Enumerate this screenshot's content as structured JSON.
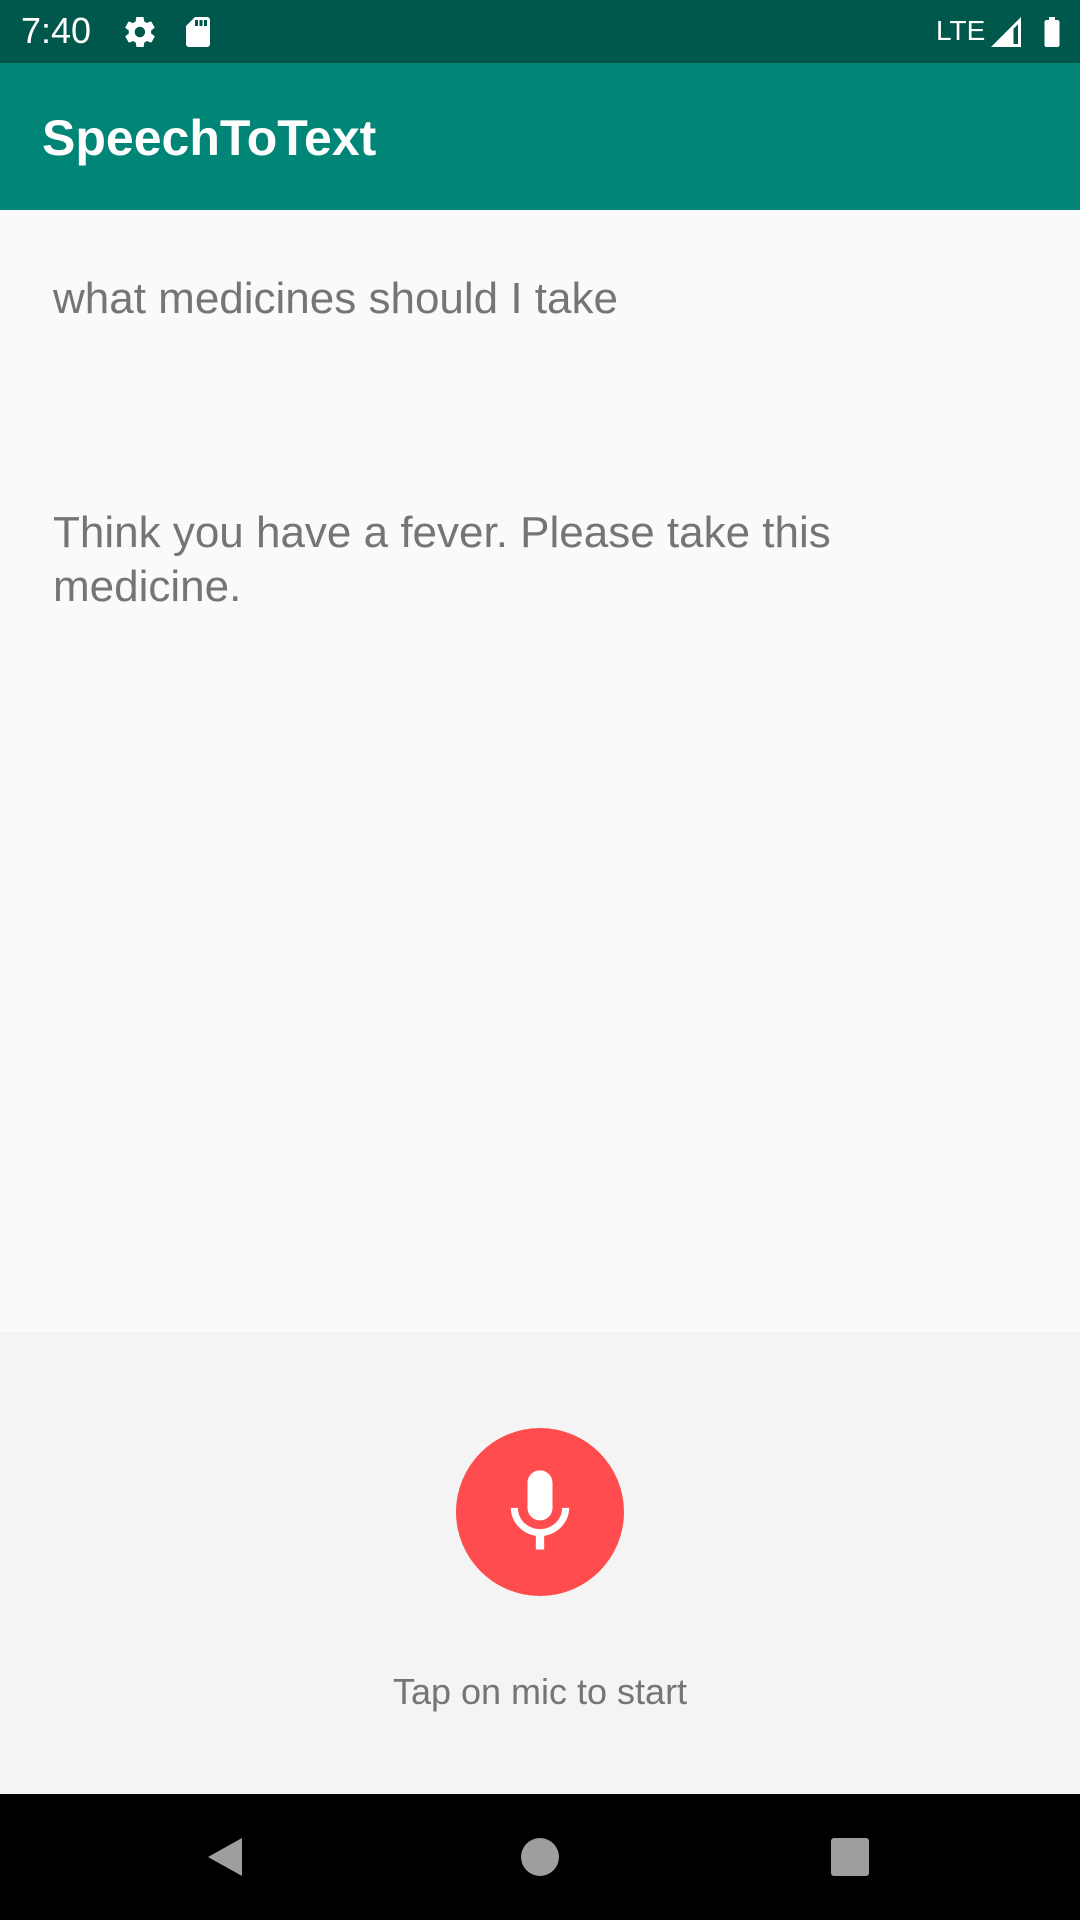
{
  "status_bar": {
    "time": "7:40",
    "network": "LTE",
    "icons": [
      "settings-icon",
      "sd-card-icon",
      "signal-icon",
      "battery-icon"
    ],
    "background": "#00574b"
  },
  "app_bar": {
    "title": "SpeechToText",
    "background": "#008577"
  },
  "main": {
    "query_text": "what medicines should I take",
    "response_text": "Think you have a fever. Please take this medicine."
  },
  "controls": {
    "mic_icon": "microphone-icon",
    "mic_color": "#ff4d4f",
    "hint": "Tap on mic to start"
  },
  "nav_bar": {
    "buttons": [
      "back-icon",
      "home-icon",
      "recents-icon"
    ]
  }
}
